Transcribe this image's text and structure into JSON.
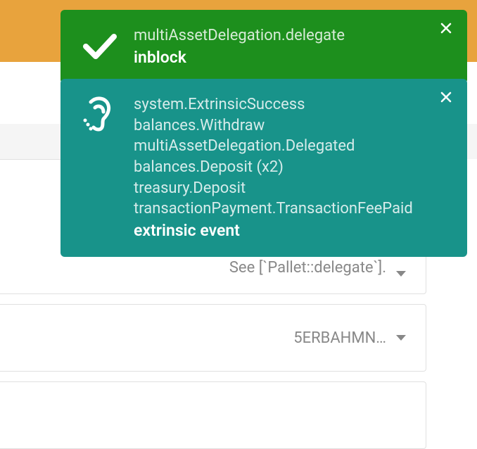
{
  "notifications": {
    "success": {
      "title": "multiAssetDelegation.delegate",
      "subtitle": "inblock"
    },
    "events": {
      "lines": [
        "system.ExtrinsicSuccess",
        "balances.Withdraw",
        "multiAssetDelegation.Delegated",
        "balances.Deposit (x2)",
        "treasury.Deposit",
        "transactionPayment.TransactionFeePaid"
      ],
      "subtitle": "extrinsic event"
    }
  },
  "panels": {
    "delegate_desc": "See [`Pallet::delegate`].",
    "account": "5ERBAHMN…"
  }
}
